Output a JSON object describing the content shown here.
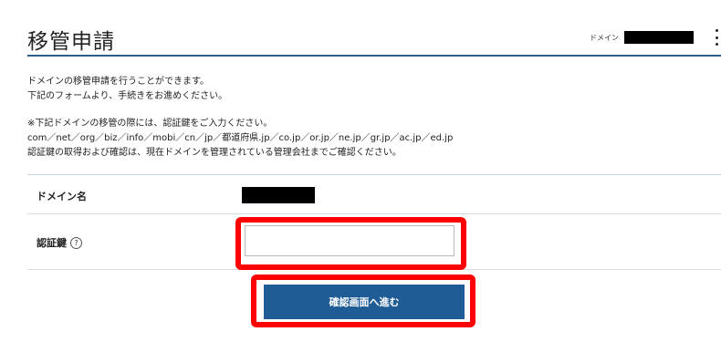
{
  "header": {
    "title": "移管申請",
    "domain_label": "ドメイン",
    "menu_icon": "kebab-icon"
  },
  "intro": {
    "line1": "ドメインの移管申請を行うことができます。",
    "line2": "下記のフォームより、手続きをお進めください。"
  },
  "notice": {
    "line1": "※下記ドメインの移管の際には、認証鍵をご入力ください。",
    "line2": "com／net／org／biz／info／mobi／cn／jp／都道府県.jp／co.jp／or.jp／ne.jp／gr.jp／ac.jp／ed.jp",
    "line3": "認証鍵の取得および確認は、現在ドメインを管理されている管理会社までご確認ください。"
  },
  "form": {
    "domain_label": "ドメイン名",
    "auth_label": "認証鍵",
    "help_icon": "?",
    "auth_value": "",
    "submit_label": "確認画面へ進む"
  },
  "colors": {
    "accent": "#1f5c96",
    "highlight": "#ff0000",
    "header_rule": "#2f5f8f"
  }
}
